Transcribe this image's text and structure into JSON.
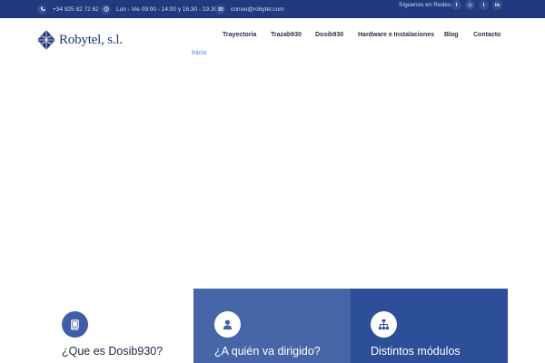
{
  "topbar": {
    "phone": "+34 925 82 72 62",
    "hours": "Lun - Vie 09:00 - 14:00 y 16.30 - 19.30",
    "email": "correo@robytel.com",
    "social_label": "Síguenos en Redes:",
    "social": [
      {
        "icon": "facebook-icon",
        "glyph": "f"
      },
      {
        "icon": "instagram-icon",
        "glyph": "◎"
      },
      {
        "icon": "twitter-icon",
        "glyph": "t"
      },
      {
        "icon": "linkedin-icon",
        "glyph": "in"
      }
    ]
  },
  "header": {
    "logo_text": "Robytel, s.l.",
    "nav": [
      "Inicio",
      "Trayectoria",
      "Trazab930",
      "Dosib930",
      "Hardware e Instalaciones",
      "Blog",
      "Contacto"
    ],
    "active_index": 0
  },
  "features": [
    {
      "title": "¿Que es Dosib930?",
      "icon": "book-icon"
    },
    {
      "title": "¿A quién va dirigido?",
      "icon": "user-icon"
    },
    {
      "title": "Distintos módulos",
      "icon": "sitemap-icon"
    }
  ],
  "colors": {
    "topbar": "#1f3a7e",
    "accent": "#4a7ed8",
    "feature2": "#4766a8",
    "feature3": "#2d4f9a"
  }
}
